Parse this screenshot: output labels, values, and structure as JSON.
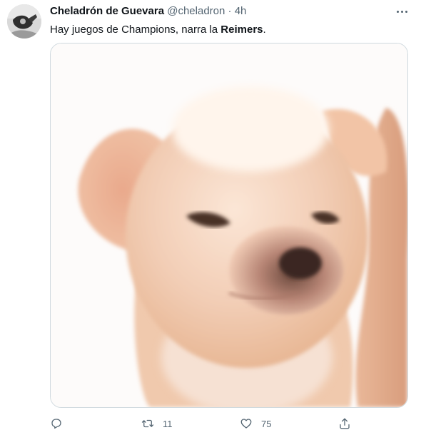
{
  "tweet": {
    "author_name": "Cheladrón de Guevara",
    "handle": "@cheladron",
    "separator": "·",
    "time": "4h",
    "text_prefix": "Hay juegos de Champions, narra la ",
    "text_bold": "Reimers",
    "text_suffix": "."
  },
  "actions": {
    "reply_count": "",
    "retweet_count": "11",
    "like_count": "75"
  },
  "icons": {
    "more": "more-icon",
    "reply": "reply-icon",
    "retweet": "retweet-icon",
    "like": "heart-icon",
    "share": "share-icon"
  },
  "colors": {
    "text": "#0f1419",
    "secondary": "#536471",
    "border": "#cfd9de"
  }
}
